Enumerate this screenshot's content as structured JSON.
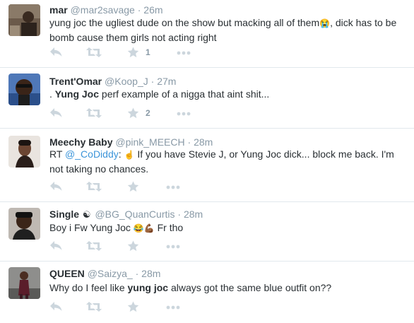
{
  "tweets": [
    {
      "fullname": "mar",
      "handle": "@mar2savage",
      "sep": "·",
      "time": "26m",
      "text_parts": [
        "yung joc the ugliest dude on the show but macking all of them",
        "😭",
        ", dick has to be bomb cause them girls not acting right"
      ],
      "favorite_count": "1"
    },
    {
      "fullname": "Trent'Omar",
      "handle": "@Koop_J",
      "sep": "·",
      "time": "27m",
      "text_parts": [
        ". ",
        "Yung Joc",
        " perf example of a nigga that aint shit..."
      ],
      "favorite_count": "2"
    },
    {
      "fullname": "Meechy Baby",
      "handle": "@pink_MEECH",
      "sep": "·",
      "time": "28m",
      "text_parts": [
        "RT ",
        "@_CoDiddy",
        ": ",
        "☝",
        " If you have Stevie J, or Yung Joc dick... block me back. I'm not taking no chances."
      ],
      "favorite_count": ""
    },
    {
      "fullname": "Single",
      "badge": "☯",
      "handle": "@BG_QuanCurtis",
      "sep": "·",
      "time": "28m",
      "text_parts": [
        "Boy i Fw Yung Joc ",
        "😂💪",
        "🏾",
        " Fr tho"
      ],
      "favorite_count": ""
    },
    {
      "fullname": "QUEEN",
      "handle": "@Saizya_",
      "sep": "·",
      "time": "28m",
      "text_parts": [
        "Why do I feel like ",
        "yung joc",
        " always got the same blue outfit on??"
      ],
      "favorite_count": ""
    }
  ],
  "icons": {
    "reply": "reply-icon",
    "retweet": "retweet-icon",
    "favorite": "star-icon",
    "more": "more-dots-icon"
  },
  "colors": {
    "name": "#292f33",
    "meta": "#8899a6",
    "icon": "#ccd6dd",
    "link": "#3b94d9",
    "divider": "#e1e8ed"
  }
}
